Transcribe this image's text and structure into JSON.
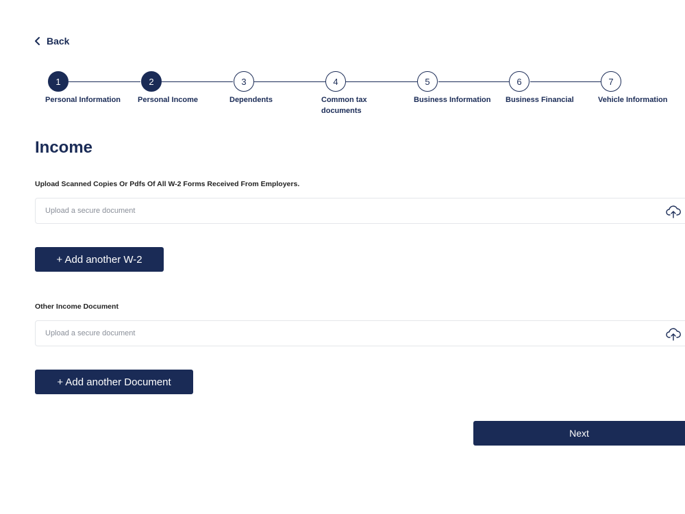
{
  "nav": {
    "back_label": "Back"
  },
  "stepper": {
    "steps": [
      {
        "number": "1",
        "label": "Personal Information",
        "state": "completed"
      },
      {
        "number": "2",
        "label": "Personal Income",
        "state": "active"
      },
      {
        "number": "3",
        "label": "Dependents",
        "state": "pending"
      },
      {
        "number": "4",
        "label": "Common tax documents",
        "state": "pending"
      },
      {
        "number": "5",
        "label": "Business Information",
        "state": "pending"
      },
      {
        "number": "6",
        "label": "Business Financial",
        "state": "pending"
      },
      {
        "number": "7",
        "label": "Vehicle Information",
        "state": "pending"
      }
    ]
  },
  "page": {
    "title": "Income"
  },
  "w2": {
    "label": "Upload Scanned Copies Or Pdfs Of All W-2 Forms Received From Employers.",
    "placeholder": "Upload a secure document",
    "add_button": "+ Add another W-2"
  },
  "other": {
    "label": "Other Income Document",
    "placeholder": "Upload a secure document",
    "add_button": "+ Add another Document"
  },
  "footer": {
    "next_label": "Next"
  },
  "colors": {
    "primary": "#1a2b56",
    "border": "#e4e6ea",
    "placeholder": "#8a8f99"
  },
  "icons": {
    "back": "chevron-left-icon",
    "upload": "cloud-upload-icon"
  }
}
